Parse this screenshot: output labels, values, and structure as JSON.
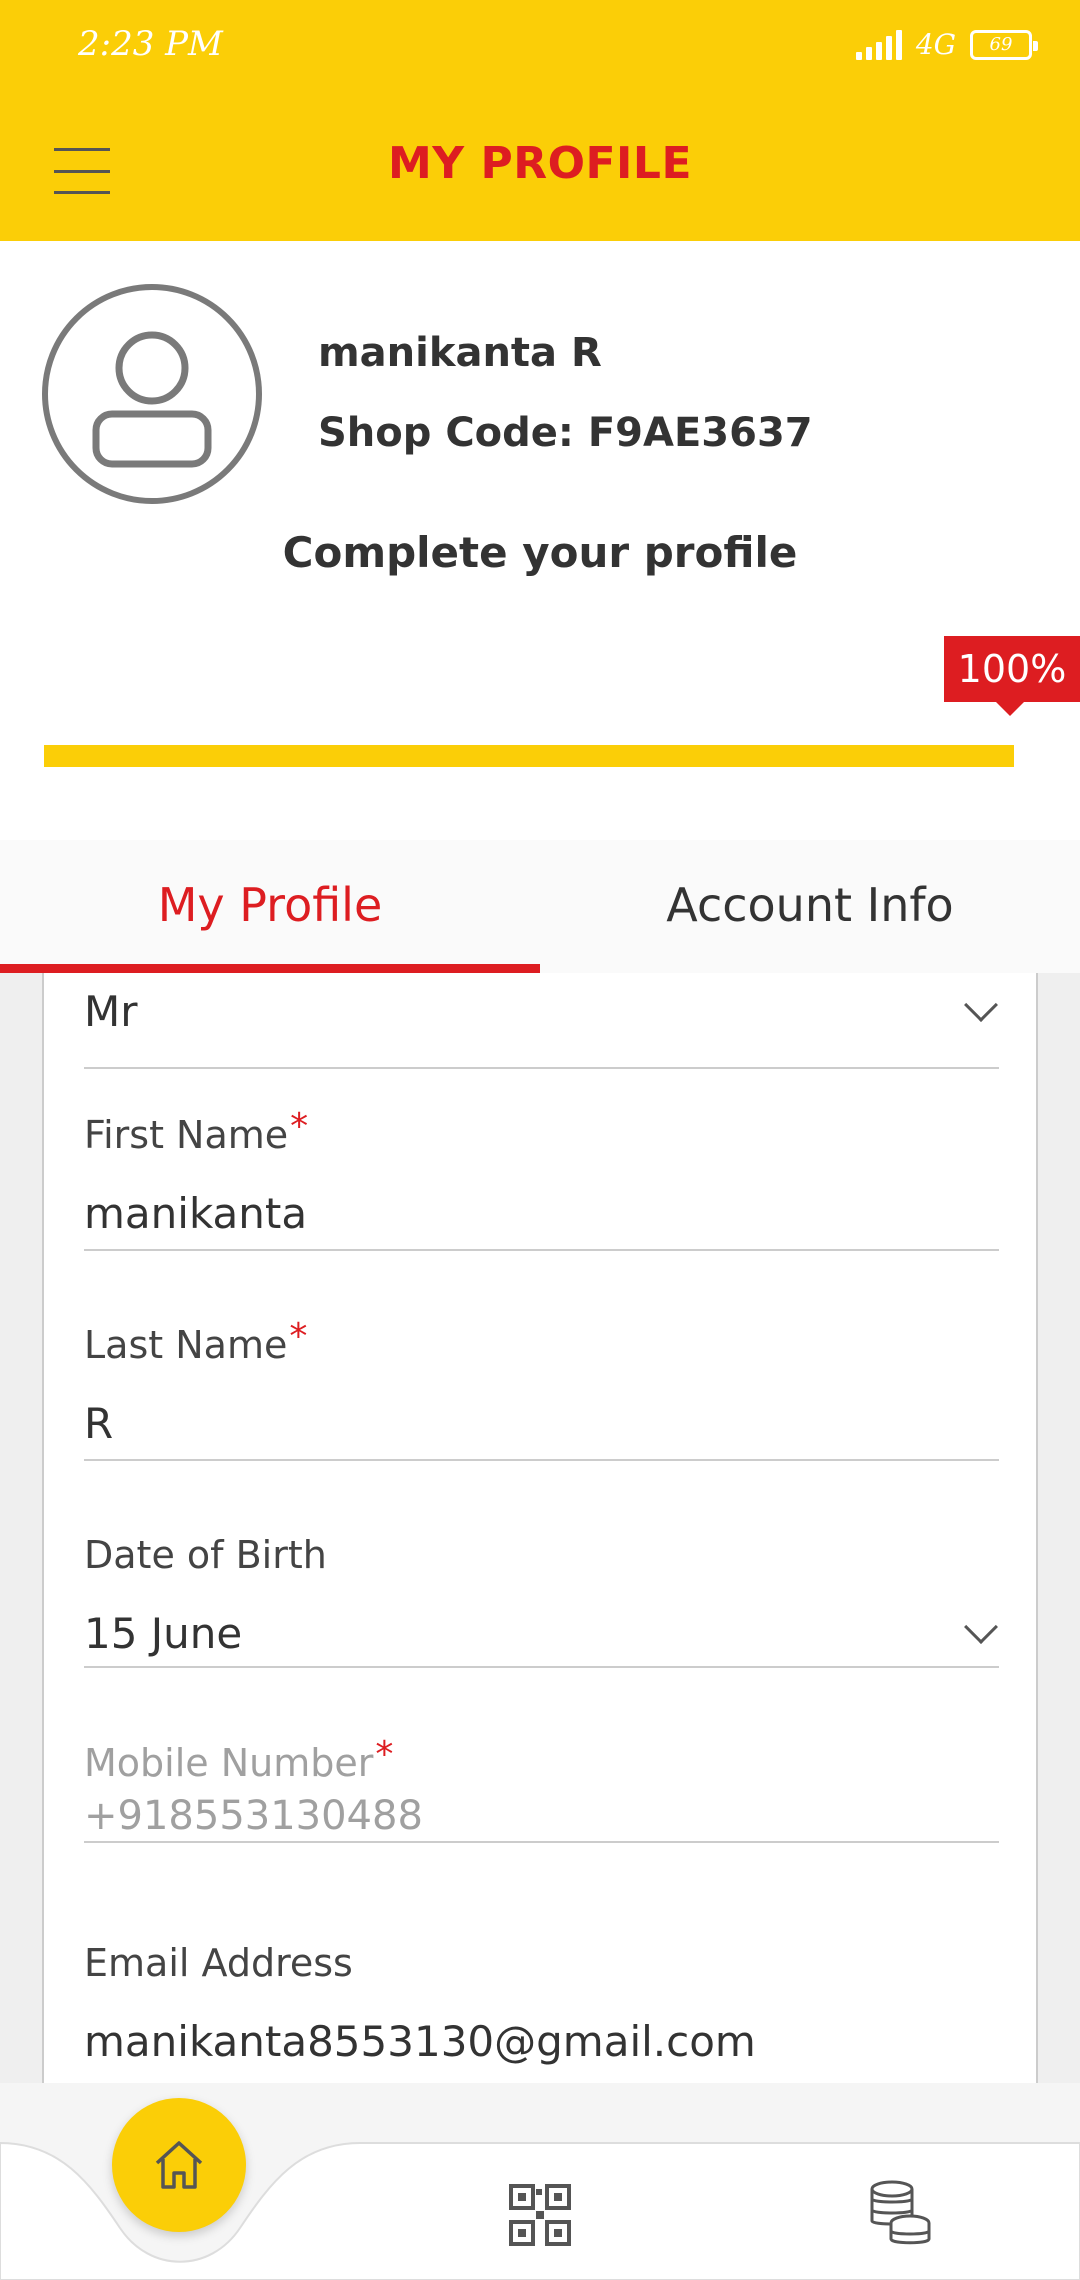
{
  "status_bar": {
    "time": "2:23 PM",
    "network": "4G",
    "battery": "69"
  },
  "app_bar": {
    "title": "MY PROFILE",
    "menu_icon": "hamburger-menu-icon"
  },
  "profile": {
    "name": "manikanta  R",
    "shop_code": "Shop Code: F9AE3637",
    "complete_prompt": "Complete your profile",
    "completion_label": "100%",
    "completion": 1.0,
    "avatar_icon": "user-avatar-icon"
  },
  "tabs": [
    {
      "label": "My Profile",
      "active": true
    },
    {
      "label": "Account Info",
      "active": false
    }
  ],
  "form": {
    "salutation": {
      "value": "Mr"
    },
    "first_name": {
      "label": "First Name",
      "required_mark": "*",
      "value": "manikanta"
    },
    "last_name": {
      "label": "Last Name",
      "required_mark": "*",
      "value": "R"
    },
    "date_of_birth": {
      "label": "Date of Birth",
      "value": "15 June"
    },
    "mobile_number": {
      "label": "Mobile Number",
      "required_mark": "*",
      "value": "+918553130488"
    },
    "email": {
      "label": "Email Address",
      "value": "manikanta8553130@gmail.com"
    }
  },
  "bottom_nav": {
    "items": [
      "home-icon",
      "qr-code-icon",
      "coins-icon"
    ]
  },
  "colors": {
    "brand_yellow": "#FBCE07",
    "brand_red": "#DD1D21",
    "text_dark": "#333333"
  }
}
